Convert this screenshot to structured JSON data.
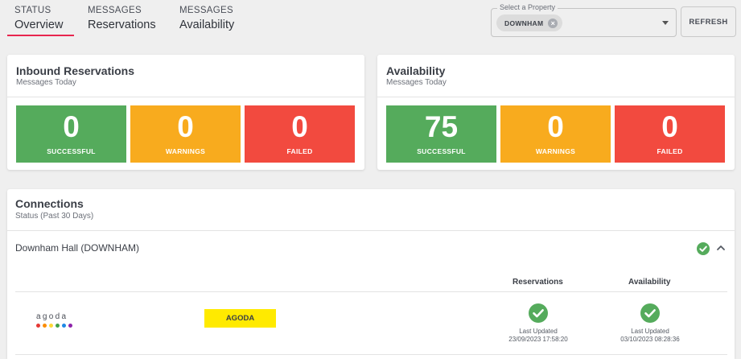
{
  "tabs": [
    {
      "kicker": "STATUS",
      "label": "Overview"
    },
    {
      "kicker": "MESSAGES",
      "label": "Reservations"
    },
    {
      "kicker": "MESSAGES",
      "label": "Availability"
    }
  ],
  "property_select": {
    "legend": "Select a Property",
    "selected_chip": "DOWNHAM"
  },
  "refresh_label": "REFRESH",
  "inbound": {
    "title": "Inbound Reservations",
    "subtitle": "Messages Today",
    "tiles": [
      {
        "value": "0",
        "label": "SUCCESSFUL"
      },
      {
        "value": "0",
        "label": "WARNINGS"
      },
      {
        "value": "0",
        "label": "FAILED"
      }
    ]
  },
  "availability": {
    "title": "Availability",
    "subtitle": "Messages Today",
    "tiles": [
      {
        "value": "75",
        "label": "SUCCESSFUL"
      },
      {
        "value": "0",
        "label": "WARNINGS"
      },
      {
        "value": "0",
        "label": "FAILED"
      }
    ]
  },
  "connections": {
    "title": "Connections",
    "subtitle": "Status (Past 30 Days)",
    "property_row": "Downham Hall (DOWNHAM)",
    "columns": [
      "Reservations",
      "Availability"
    ],
    "rows": [
      {
        "logo_text": "agoda",
        "channel_badge": "AGODA",
        "reservations": {
          "last_updated_label": "Last Updated",
          "timestamp": "23/09/2023 17:58:20"
        },
        "availability": {
          "last_updated_label": "Last Updated",
          "timestamp": "03/10/2023 08:28:36"
        }
      }
    ]
  },
  "colors": {
    "accent": "#e8264f",
    "success": "#55ab5c",
    "warning": "#f8ab1e",
    "failed": "#f24a3f",
    "badge_yellow": "#ffea00",
    "agoda_dots": [
      "#e53935",
      "#fb8c00",
      "#fdd835",
      "#43a047",
      "#1e88e5",
      "#8e24aa"
    ]
  },
  "icons": {
    "status_ok": "check-circle-icon",
    "collapse": "chevron-up-icon",
    "clear_chip": "close-icon",
    "dropdown": "caret-down-icon"
  }
}
